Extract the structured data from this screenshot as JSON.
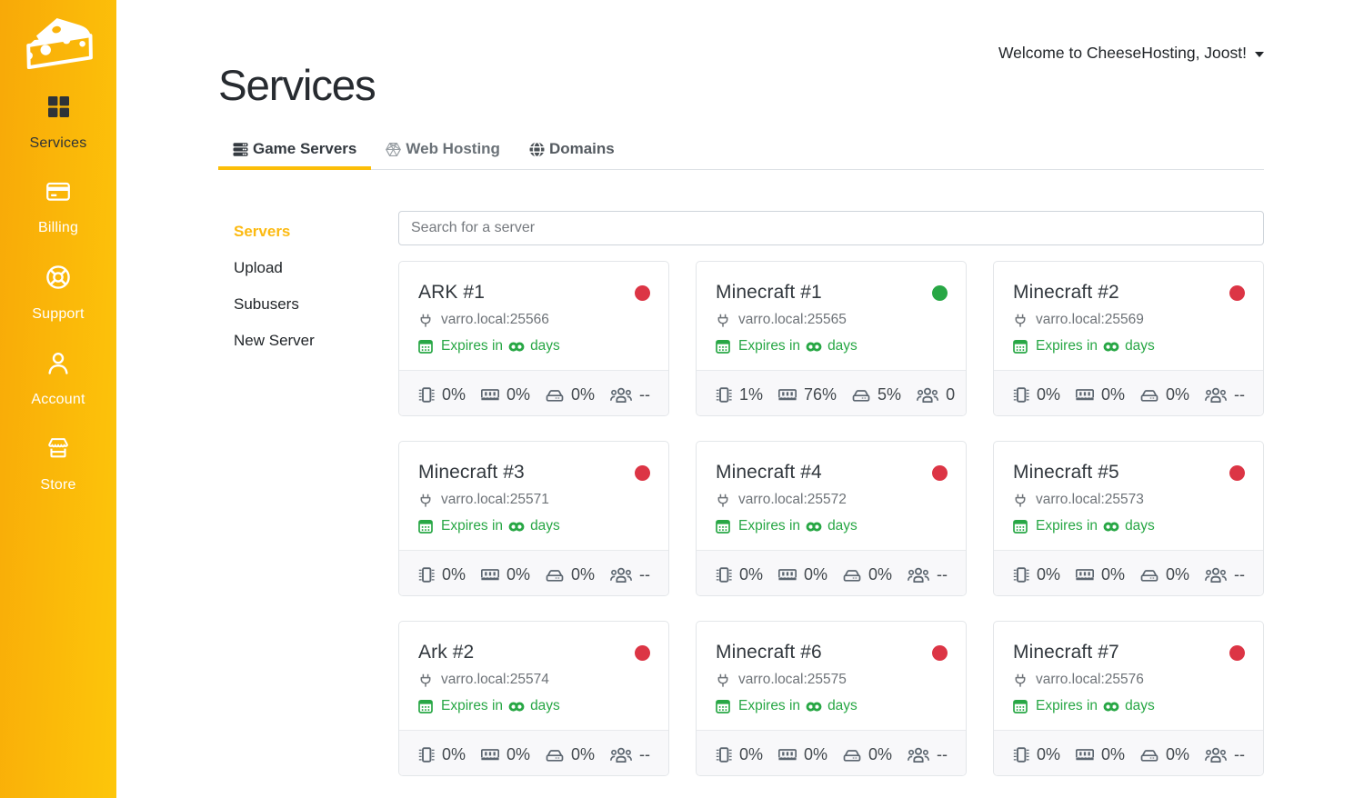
{
  "app": {
    "name": "CheeseHosting"
  },
  "colors": {
    "accent": "#fcbe08",
    "online": "#28a745",
    "offline": "#dc3545",
    "sidebar_gradient_start": "#f7a808",
    "sidebar_gradient_end": "#fdc30b"
  },
  "sidebar": {
    "logo_icon": "cheese-wedge-icon",
    "items": [
      {
        "label": "Services",
        "icon": "grid-icon",
        "active": true
      },
      {
        "label": "Billing",
        "icon": "credit-card-icon",
        "active": false
      },
      {
        "label": "Support",
        "icon": "life-ring-icon",
        "active": false
      },
      {
        "label": "Account",
        "icon": "person-icon",
        "active": false
      },
      {
        "label": "Store",
        "icon": "storefront-icon",
        "active": false
      }
    ]
  },
  "header": {
    "title": "Services",
    "welcome": "Welcome to CheeseHosting, Joost!"
  },
  "tabs": [
    {
      "label": "Game Servers",
      "icon": "server-stack-icon",
      "active": true
    },
    {
      "label": "Web Hosting",
      "icon": "hexagon-icon",
      "active": false
    },
    {
      "label": "Domains",
      "icon": "globe-icon",
      "active": false
    }
  ],
  "subnav": {
    "items": [
      {
        "label": "Servers",
        "active": true
      },
      {
        "label": "Upload",
        "active": false
      },
      {
        "label": "Subusers",
        "active": false
      },
      {
        "label": "New Server",
        "active": false
      }
    ]
  },
  "search": {
    "placeholder": "Search for a server"
  },
  "card_labels": {
    "expires_prefix": "Expires in",
    "expires_suffix": "days"
  },
  "servers": [
    {
      "name": "ARK #1",
      "address": "varro.local:25566",
      "status": "offline",
      "cpu": "0%",
      "memory": "0%",
      "disk": "0%",
      "players": "--"
    },
    {
      "name": "Minecraft #1",
      "address": "varro.local:25565",
      "status": "online",
      "cpu": "1%",
      "memory": "76%",
      "disk": "5%",
      "players": "0"
    },
    {
      "name": "Minecraft #2",
      "address": "varro.local:25569",
      "status": "offline",
      "cpu": "0%",
      "memory": "0%",
      "disk": "0%",
      "players": "--"
    },
    {
      "name": "Minecraft #3",
      "address": "varro.local:25571",
      "status": "offline",
      "cpu": "0%",
      "memory": "0%",
      "disk": "0%",
      "players": "--"
    },
    {
      "name": "Minecraft #4",
      "address": "varro.local:25572",
      "status": "offline",
      "cpu": "0%",
      "memory": "0%",
      "disk": "0%",
      "players": "--"
    },
    {
      "name": "Minecraft #5",
      "address": "varro.local:25573",
      "status": "offline",
      "cpu": "0%",
      "memory": "0%",
      "disk": "0%",
      "players": "--"
    },
    {
      "name": "Ark #2",
      "address": "varro.local:25574",
      "status": "offline",
      "cpu": "0%",
      "memory": "0%",
      "disk": "0%",
      "players": "--"
    },
    {
      "name": "Minecraft #6",
      "address": "varro.local:25575",
      "status": "offline",
      "cpu": "0%",
      "memory": "0%",
      "disk": "0%",
      "players": "--"
    },
    {
      "name": "Minecraft #7",
      "address": "varro.local:25576",
      "status": "offline",
      "cpu": "0%",
      "memory": "0%",
      "disk": "0%",
      "players": "--"
    }
  ]
}
